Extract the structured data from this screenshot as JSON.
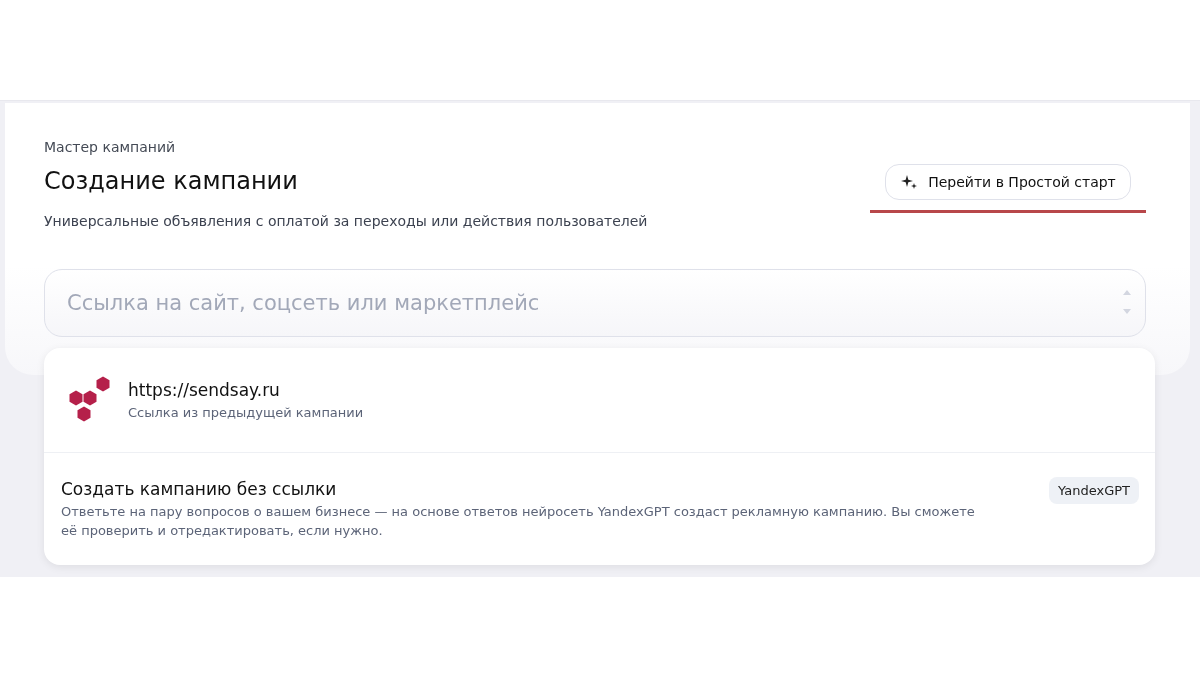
{
  "header": {
    "breadcrumb": "Мастер кампаний",
    "title": "Создание кампании",
    "subtitle": "Универсальные объявления с оплатой за переходы или действия пользователей",
    "simple_start_button": "Перейти в Простой старт"
  },
  "url_field": {
    "placeholder": "Ссылка на сайт, соцсеть или маркетплейс"
  },
  "suggestions": [
    {
      "kind": "link",
      "title": "https://sendsay.ru",
      "caption": "Ссылка из предыдущей кампании"
    },
    {
      "kind": "no-link",
      "title": "Создать кампанию без ссылки",
      "caption": "Ответьте на пару вопросов о вашем бизнесе — на основе ответов нейросеть YandexGPT создаст рекламную кампанию. Вы сможете её проверить и отредактировать, если нужно.",
      "badge": "YandexGPT"
    }
  ]
}
